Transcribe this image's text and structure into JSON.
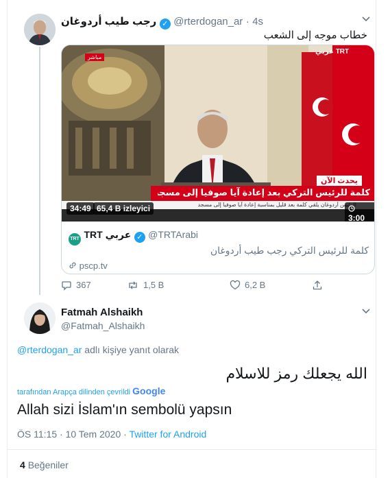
{
  "tweet1": {
    "display_name": "رجب طيب أردوغان",
    "handle": "@rterdogan_ar",
    "time": "4s",
    "text": "خطاب موجه إلى الشعب",
    "video": {
      "broadcast_label": "يحدث الآن",
      "headline": "كلمة للرئيس التركي بعد إعادة آيا صوفيا إلى مسجد",
      "ticker": "الرئيس أردوغان يلقي كلمة بعد قليل بمناسبة إعادة آيا صوفيا إلى مسجد",
      "live_badge": "مباشر",
      "channel_logo": "TRT عربي",
      "duration": "34:49",
      "viewers": "65,4 B izleyici",
      "timer": "3:00"
    },
    "card": {
      "display_name": "TRT عربي",
      "handle": "@TRTArabi",
      "text": "كلمة للرئيس التركي رجب طيب أردوغان",
      "link": "pscp.tv"
    },
    "actions": {
      "replies": "367",
      "retweets": "1,5 B",
      "likes": "6,2 B"
    }
  },
  "tweet2": {
    "display_name": "Fatmah Alshaikh",
    "handle": "@Fatmah_Alshaikh",
    "reply_to_handle": "@rterdogan_ar",
    "reply_to_suffix": " adlı kişiye yanıt olarak",
    "text": "الله يجعلك رمز للاسلام",
    "translated_by_prefix": "tarafından Arapça dilinden çevrildi",
    "translator": "Google",
    "translation": "Allah sizi İslam'ın sembolü yapsın",
    "timestamp": "ÖS 11:15 · 10 Tem 2020 · ",
    "source": "Twitter for Android",
    "likes_count": "4",
    "likes_label": "Beğeniler"
  },
  "colors": {
    "twitter_blue": "#1da1f2",
    "muted": "#657786",
    "border": "#e6ecf0",
    "video_red": "#d40017"
  },
  "icons": [
    "verified-icon",
    "chevron-down-icon",
    "reply-icon",
    "retweet-icon",
    "like-icon",
    "share-icon",
    "link-icon",
    "views-icon",
    "timer-icon"
  ]
}
